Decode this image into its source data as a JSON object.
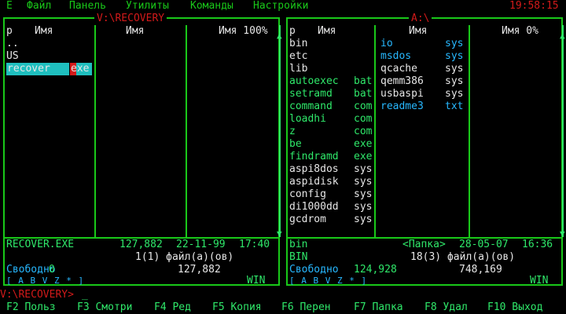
{
  "menu": {
    "items": [
      "Е",
      "Файл",
      "Панель",
      "Утилиты",
      "Команды",
      "Настройки"
    ],
    "clock": "19:58:15"
  },
  "left_panel": {
    "path": "V:\\RECOVERY",
    "headers": [
      "р",
      "Имя",
      "Имя",
      "Имя 100%"
    ],
    "files": [
      {
        "name": "..",
        "ext": ""
      },
      {
        "name": "US",
        "ext": ""
      },
      {
        "name": "recover",
        "ext": "exe"
      }
    ],
    "selected_file": "RECOVER.EXE",
    "selected_size": "127,882",
    "selected_date": "22-11-99",
    "selected_time": "17:40",
    "files_count": "1(1) файл(а)(ов)",
    "files_size": "127,882",
    "free_label": "Свободно",
    "free_value": "0",
    "drives": "[ A B V Z * ]",
    "win_label": "WIN"
  },
  "right_panel": {
    "path": "A:\\",
    "headers": [
      "р",
      "Имя",
      "Имя",
      "Имя 0%"
    ],
    "col1": [
      {
        "name": "bin",
        "ext": ""
      },
      {
        "name": "etc",
        "ext": ""
      },
      {
        "name": "lib",
        "ext": ""
      },
      {
        "name": "autoexec",
        "ext": "bat"
      },
      {
        "name": "setramd",
        "ext": "bat"
      },
      {
        "name": "command",
        "ext": "com"
      },
      {
        "name": "loadhi",
        "ext": "com"
      },
      {
        "name": "z",
        "ext": "com"
      },
      {
        "name": "be",
        "ext": "exe"
      },
      {
        "name": "findramd",
        "ext": "exe"
      },
      {
        "name": "aspi8dos",
        "ext": "sys"
      },
      {
        "name": "aspidisk",
        "ext": "sys"
      },
      {
        "name": "config",
        "ext": "sys"
      },
      {
        "name": "di1000dd",
        "ext": "sys"
      },
      {
        "name": "gcdrom",
        "ext": "sys"
      }
    ],
    "col2": [
      {
        "name": "io",
        "ext": "sys"
      },
      {
        "name": "msdos",
        "ext": "sys"
      },
      {
        "name": "qcache",
        "ext": "sys"
      },
      {
        "name": "qemm386",
        "ext": "sys"
      },
      {
        "name": "usbaspi",
        "ext": "sys"
      },
      {
        "name": "readme3",
        "ext": "txt"
      }
    ],
    "selected_file": "bin",
    "selected_info": "<Папка>",
    "selected_date": "28-05-07",
    "selected_time": "16:36",
    "selected_upper": "BIN",
    "files_count": "18(3) файл(а)(ов)",
    "files_size": "748,169",
    "free_label": "Свободно",
    "free_value": "124,928",
    "drives": "[ A B V Z * ]",
    "win_label": "WIN"
  },
  "prompt": "V:\\RECOVERY>",
  "fkeys": [
    {
      "key": "F2",
      "label": "Польз"
    },
    {
      "key": "F3",
      "label": "Смотри"
    },
    {
      "key": "F4",
      "label": "Ред"
    },
    {
      "key": "F5",
      "label": "Копия"
    },
    {
      "key": "F6",
      "label": "Перен"
    },
    {
      "key": "F7",
      "label": "Папка"
    },
    {
      "key": "F8",
      "label": "Удал"
    },
    {
      "key": "F10",
      "label": "Выход"
    }
  ],
  "colors": {
    "frame": "#19c819",
    "text_green": "#2fe86a",
    "accent_red": "#d21a1a",
    "cyan": "#27b8ff",
    "selection": "#1fbfbf"
  }
}
